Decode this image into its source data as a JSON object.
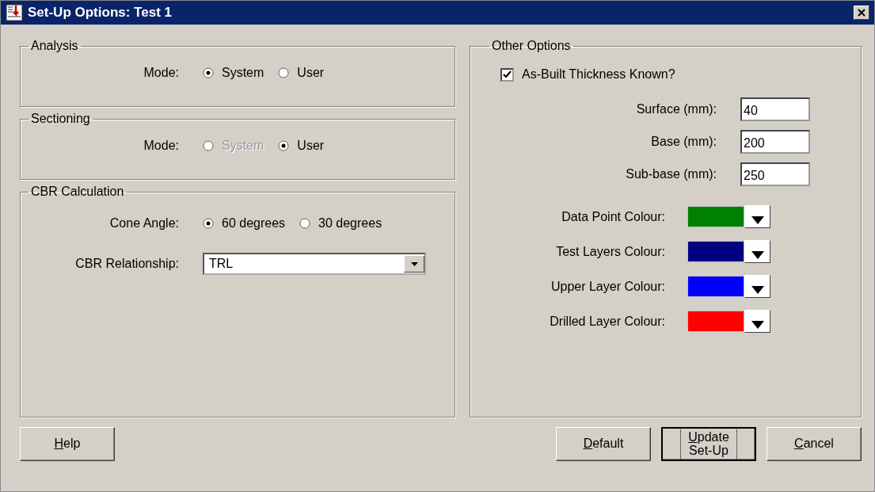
{
  "window": {
    "title": "Set-Up Options: Test 1"
  },
  "analysis": {
    "title": "Analysis",
    "label": "Mode:",
    "options": [
      {
        "label": "System",
        "selected": true,
        "disabled": false
      },
      {
        "label": "User",
        "selected": false,
        "disabled": false
      }
    ]
  },
  "sectioning": {
    "title": "Sectioning",
    "label": "Mode:",
    "options": [
      {
        "label": "System",
        "selected": false,
        "disabled": true
      },
      {
        "label": "User",
        "selected": true,
        "disabled": false
      }
    ]
  },
  "cbr": {
    "title": "CBR Calculation",
    "cone_label": "Cone Angle:",
    "cone_options": [
      {
        "label": "60 degrees",
        "selected": true,
        "disabled": false
      },
      {
        "label": "30 degrees",
        "selected": false,
        "disabled": false
      }
    ],
    "relationship_label": "CBR Relationship:",
    "relationship_value": "TRL"
  },
  "other": {
    "title": "Other Options",
    "thickness_known": {
      "label": "As-Built Thickness Known?",
      "checked": true
    },
    "thicknesses": [
      {
        "label": "Surface (mm):",
        "value": "40"
      },
      {
        "label": "Base (mm):",
        "value": "200"
      },
      {
        "label": "Sub-base (mm):",
        "value": "250"
      }
    ],
    "colours": [
      {
        "label": "Data Point Colour:",
        "color": "#008000"
      },
      {
        "label": "Test Layers Colour:",
        "color": "#000080"
      },
      {
        "label": "Upper Layer Colour:",
        "color": "#0000ff"
      },
      {
        "label": "Drilled Layer Colour:",
        "color": "#ff0000"
      }
    ]
  },
  "buttons": [
    {
      "key": "H",
      "after": "elp",
      "default": false
    },
    {
      "key": "D",
      "after": "efault",
      "default": false
    },
    {
      "key": "U",
      "after": "pdate\nSet-Up",
      "default": true
    },
    {
      "key": "C",
      "after": "ancel",
      "default": false
    }
  ]
}
